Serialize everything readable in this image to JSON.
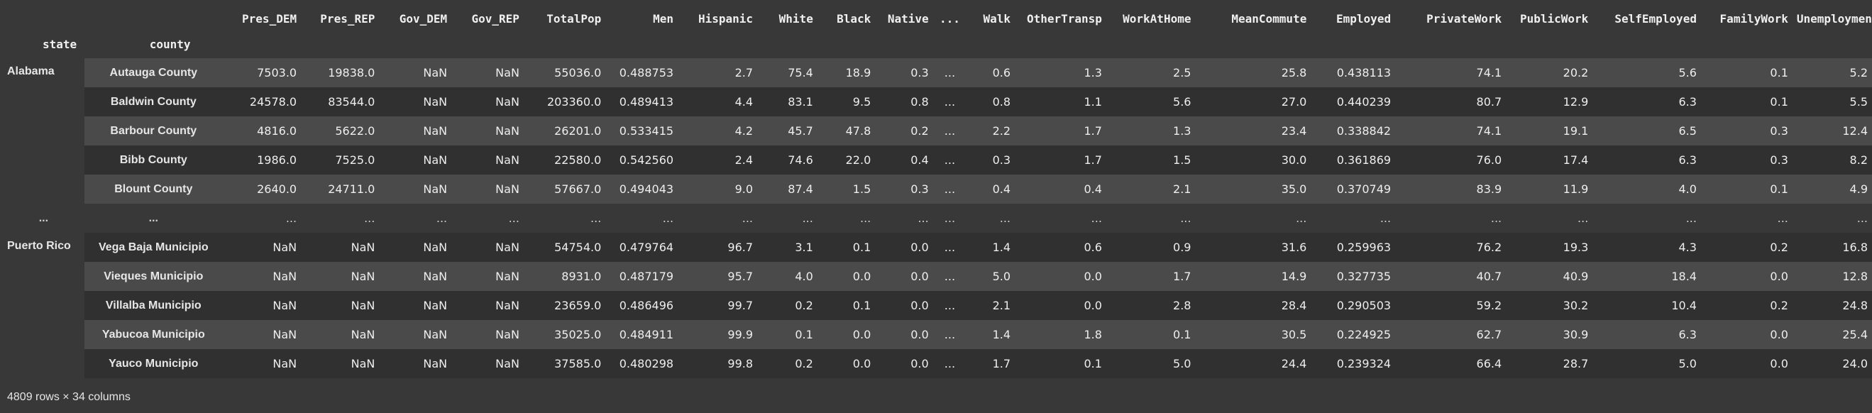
{
  "index_names": {
    "state": "state",
    "county": "county"
  },
  "columns": [
    "Pres_DEM",
    "Pres_REP",
    "Gov_DEM",
    "Gov_REP",
    "TotalPop",
    "Men",
    "Hispanic",
    "White",
    "Black",
    "Native",
    "...",
    "Walk",
    "OtherTransp",
    "WorkAtHome",
    "MeanCommute",
    "Employed",
    "PrivateWork",
    "PublicWork",
    "SelfEmployed",
    "FamilyWork",
    "Unemployment"
  ],
  "rows": [
    {
      "state": "Alabama",
      "county": "Autauga County",
      "cells": [
        "7503.0",
        "19838.0",
        "NaN",
        "NaN",
        "55036.0",
        "0.488753",
        "2.7",
        "75.4",
        "18.9",
        "0.3",
        "...",
        "0.6",
        "1.3",
        "2.5",
        "25.8",
        "0.438113",
        "74.1",
        "20.2",
        "5.6",
        "0.1",
        "5.2"
      ]
    },
    {
      "state": "",
      "county": "Baldwin County",
      "cells": [
        "24578.0",
        "83544.0",
        "NaN",
        "NaN",
        "203360.0",
        "0.489413",
        "4.4",
        "83.1",
        "9.5",
        "0.8",
        "...",
        "0.8",
        "1.1",
        "5.6",
        "27.0",
        "0.440239",
        "80.7",
        "12.9",
        "6.3",
        "0.1",
        "5.5"
      ]
    },
    {
      "state": "",
      "county": "Barbour County",
      "cells": [
        "4816.0",
        "5622.0",
        "NaN",
        "NaN",
        "26201.0",
        "0.533415",
        "4.2",
        "45.7",
        "47.8",
        "0.2",
        "...",
        "2.2",
        "1.7",
        "1.3",
        "23.4",
        "0.338842",
        "74.1",
        "19.1",
        "6.5",
        "0.3",
        "12.4"
      ]
    },
    {
      "state": "",
      "county": "Bibb County",
      "cells": [
        "1986.0",
        "7525.0",
        "NaN",
        "NaN",
        "22580.0",
        "0.542560",
        "2.4",
        "74.6",
        "22.0",
        "0.4",
        "...",
        "0.3",
        "1.7",
        "1.5",
        "30.0",
        "0.361869",
        "76.0",
        "17.4",
        "6.3",
        "0.3",
        "8.2"
      ]
    },
    {
      "state": "",
      "county": "Blount County",
      "cells": [
        "2640.0",
        "24711.0",
        "NaN",
        "NaN",
        "57667.0",
        "0.494043",
        "9.0",
        "87.4",
        "1.5",
        "0.3",
        "...",
        "0.4",
        "0.4",
        "2.1",
        "35.0",
        "0.370749",
        "83.9",
        "11.9",
        "4.0",
        "0.1",
        "4.9"
      ]
    },
    {
      "state": "...",
      "county": "...",
      "ellipsis": true,
      "cells": [
        "...",
        "...",
        "...",
        "...",
        "...",
        "...",
        "...",
        "...",
        "...",
        "...",
        "...",
        "...",
        "...",
        "...",
        "...",
        "...",
        "...",
        "...",
        "...",
        "...",
        "..."
      ]
    },
    {
      "state": "Puerto Rico",
      "county": "Vega Baja Municipio",
      "cells": [
        "NaN",
        "NaN",
        "NaN",
        "NaN",
        "54754.0",
        "0.479764",
        "96.7",
        "3.1",
        "0.1",
        "0.0",
        "...",
        "1.4",
        "0.6",
        "0.9",
        "31.6",
        "0.259963",
        "76.2",
        "19.3",
        "4.3",
        "0.2",
        "16.8"
      ]
    },
    {
      "state": "",
      "county": "Vieques Municipio",
      "cells": [
        "NaN",
        "NaN",
        "NaN",
        "NaN",
        "8931.0",
        "0.487179",
        "95.7",
        "4.0",
        "0.0",
        "0.0",
        "...",
        "5.0",
        "0.0",
        "1.7",
        "14.9",
        "0.327735",
        "40.7",
        "40.9",
        "18.4",
        "0.0",
        "12.8"
      ]
    },
    {
      "state": "",
      "county": "Villalba Municipio",
      "cells": [
        "NaN",
        "NaN",
        "NaN",
        "NaN",
        "23659.0",
        "0.486496",
        "99.7",
        "0.2",
        "0.1",
        "0.0",
        "...",
        "2.1",
        "0.0",
        "2.8",
        "28.4",
        "0.290503",
        "59.2",
        "30.2",
        "10.4",
        "0.2",
        "24.8"
      ]
    },
    {
      "state": "",
      "county": "Yabucoa Municipio",
      "cells": [
        "NaN",
        "NaN",
        "NaN",
        "NaN",
        "35025.0",
        "0.484911",
        "99.9",
        "0.1",
        "0.0",
        "0.0",
        "...",
        "1.4",
        "1.8",
        "0.1",
        "30.5",
        "0.224925",
        "62.7",
        "30.9",
        "6.3",
        "0.0",
        "25.4"
      ]
    },
    {
      "state": "",
      "county": "Yauco Municipio",
      "cells": [
        "NaN",
        "NaN",
        "NaN",
        "NaN",
        "37585.0",
        "0.480298",
        "99.8",
        "0.2",
        "0.0",
        "0.0",
        "...",
        "1.7",
        "0.1",
        "5.0",
        "24.4",
        "0.239324",
        "66.4",
        "28.7",
        "5.0",
        "0.0",
        "24.0"
      ]
    }
  ],
  "footer": "4809 rows × 34 columns",
  "colors": {
    "background": "#383838",
    "row_light": "#4a4a4a",
    "row_dark": "#303030",
    "text": "#e6e6e6"
  }
}
